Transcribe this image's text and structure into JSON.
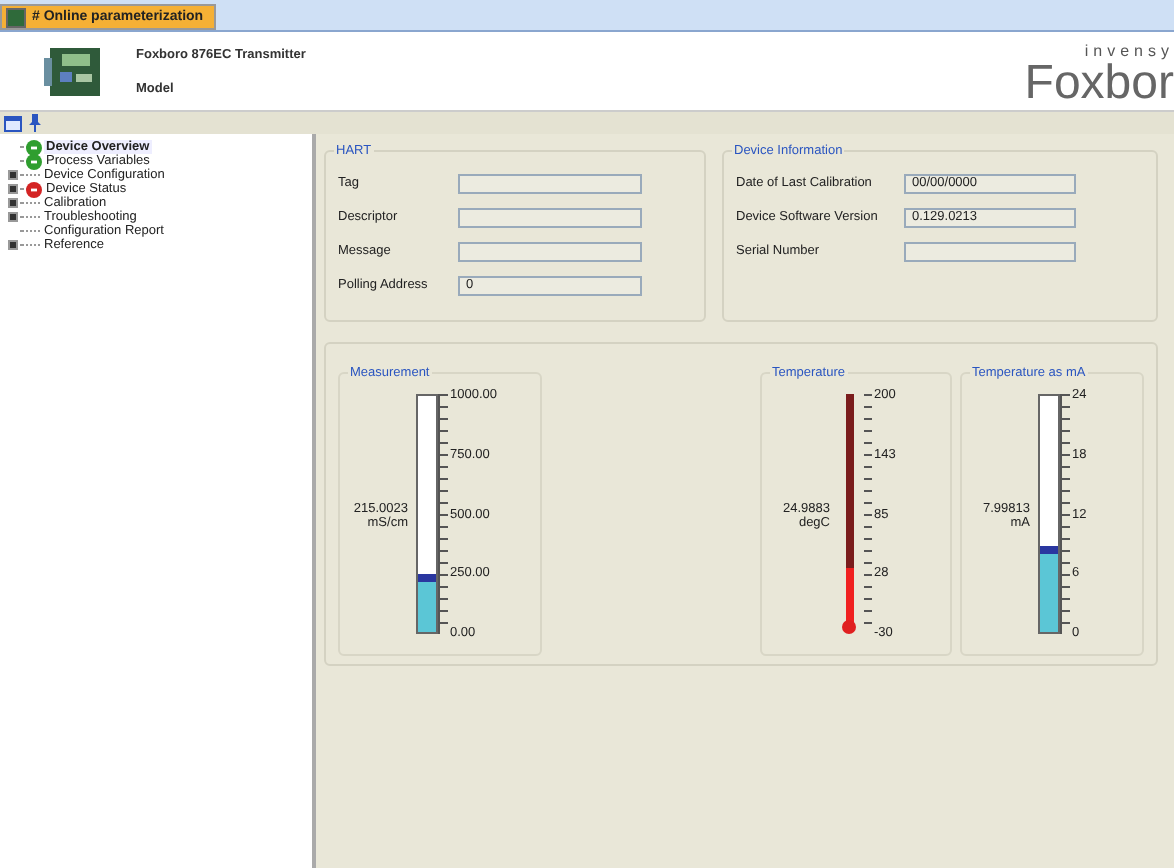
{
  "tab": {
    "label": "# Online parameterization",
    "selected": true
  },
  "header": {
    "device_name": "Foxboro 876EC Transmitter",
    "model_label": "Model",
    "logo_top": "invensy",
    "logo_main": "Foxbor"
  },
  "tree": [
    {
      "label": "Device Overview",
      "selected": true,
      "kind": "leaf",
      "color": "#2f9e2f"
    },
    {
      "label": "Process Variables",
      "selected": false,
      "kind": "leaf",
      "color": "#2f9e2f"
    },
    {
      "label": "Device Configuration",
      "selected": false,
      "kind": "branch",
      "expanded": false
    },
    {
      "label": "Device Status",
      "selected": false,
      "kind": "branch",
      "expanded": false,
      "color": "#d42424"
    },
    {
      "label": "Calibration",
      "selected": false,
      "kind": "branch",
      "expanded": false
    },
    {
      "label": "Troubleshooting",
      "selected": false,
      "kind": "branch",
      "expanded": false
    },
    {
      "label": "Configuration Report",
      "selected": false,
      "kind": "leaf"
    },
    {
      "label": "Reference",
      "selected": false,
      "kind": "branch",
      "expanded": false
    }
  ],
  "hart": {
    "title": "HART",
    "fields": [
      {
        "label": "Tag"
      },
      {
        "label": "Descriptor"
      },
      {
        "label": "Message"
      },
      {
        "label": "Polling Address",
        "value": "0"
      }
    ]
  },
  "device_information": {
    "title": "Device Information",
    "fields": [
      {
        "label": "Date of Last Calibration",
        "value": "00/00/0000"
      },
      {
        "label": "Device Software Version",
        "value": "0.129.0213"
      },
      {
        "label": "Serial Number"
      }
    ]
  },
  "gauges": [
    {
      "title": "Measurement",
      "kind": "bar",
      "value": "215.0023",
      "unit": "mS/cm",
      "level": 0.215,
      "ticks": [
        "1000.00",
        "750.00",
        "500.00",
        "250.00",
        "0.00"
      ]
    },
    {
      "title": "Temperature",
      "kind": "thermometer",
      "value": "24.9883",
      "unit": "degC",
      "level": 0.24,
      "ticks": [
        "200",
        "143",
        "85",
        "28",
        "-30"
      ]
    },
    {
      "title": "Temperature as mA",
      "kind": "bar",
      "value": "7.99813",
      "unit": "mA",
      "level": 0.333,
      "ticks": [
        "24",
        "18",
        "12",
        "6",
        "0"
      ]
    }
  ]
}
